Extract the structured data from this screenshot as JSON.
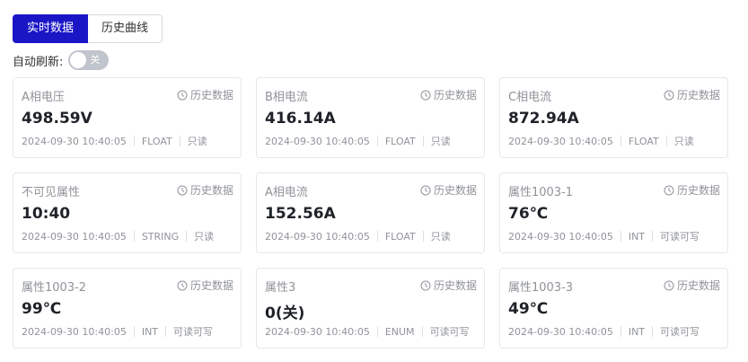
{
  "tabs": [
    {
      "label": "实时数据",
      "active": true
    },
    {
      "label": "历史曲线",
      "active": false
    }
  ],
  "refresh": {
    "label": "自动刷新:",
    "switch_text": "关",
    "enabled": false
  },
  "history_label": "历史数据",
  "cards": [
    {
      "name": "A相电压",
      "value": "498.59V",
      "time": "2024-09-30 10:40:05",
      "type": "FLOAT",
      "access": "只读"
    },
    {
      "name": "B相电流",
      "value": "416.14A",
      "time": "2024-09-30 10:40:05",
      "type": "FLOAT",
      "access": "只读"
    },
    {
      "name": "C相电流",
      "value": "872.94A",
      "time": "2024-09-30 10:40:05",
      "type": "FLOAT",
      "access": "只读"
    },
    {
      "name": "不可见属性",
      "value": "10:40",
      "time": "2024-09-30 10:40:05",
      "type": "STRING",
      "access": "只读"
    },
    {
      "name": "A相电流",
      "value": "152.56A",
      "time": "2024-09-30 10:40:05",
      "type": "FLOAT",
      "access": "只读"
    },
    {
      "name": "属性1003-1",
      "value": "76℃",
      "time": "2024-09-30 10:40:05",
      "type": "INT",
      "access": "可读可写"
    },
    {
      "name": "属性1003-2",
      "value": "99℃",
      "time": "2024-09-30 10:40:05",
      "type": "INT",
      "access": "可读可写"
    },
    {
      "name": "属性3",
      "value": "0(关)",
      "time": "2024-09-30 10:40:05",
      "type": "ENUM",
      "access": "可读可写"
    },
    {
      "name": "属性1003-3",
      "value": "49℃",
      "time": "2024-09-30 10:40:05",
      "type": "INT",
      "access": "可读可写"
    }
  ]
}
